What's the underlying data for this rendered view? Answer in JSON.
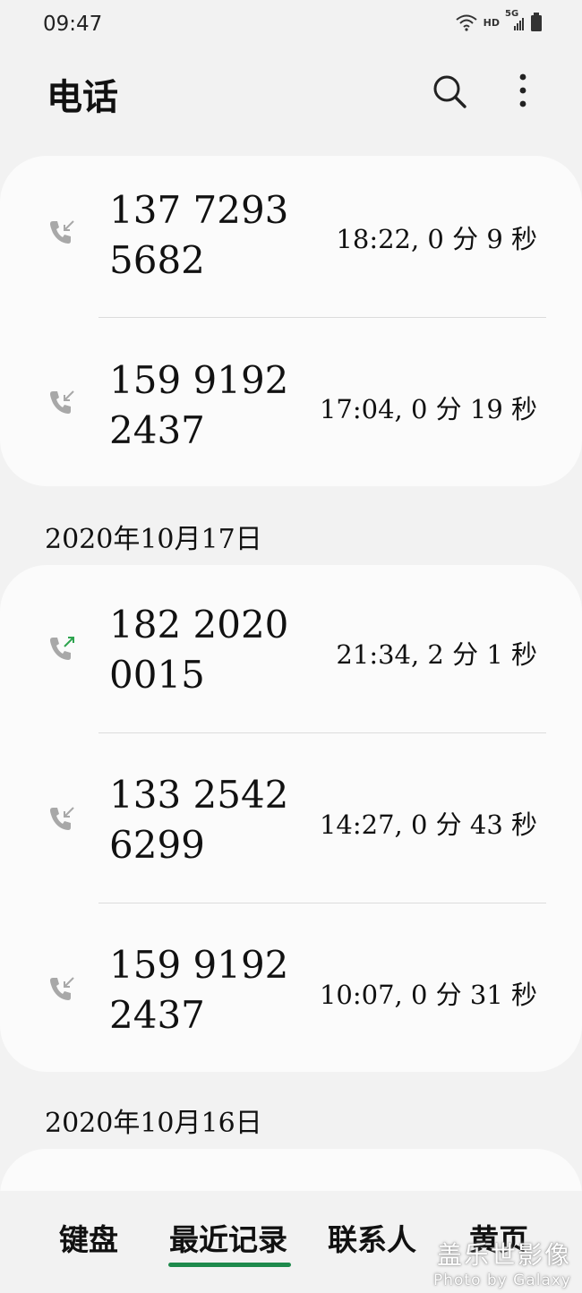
{
  "status_bar": {
    "time": "09:47",
    "hd_label": "HD",
    "net_label": "5G"
  },
  "header": {
    "title": "电话"
  },
  "groups": [
    {
      "date": "",
      "calls": [
        {
          "number_line1": "137 7293",
          "number_line2": "5682",
          "meta": "18:22, 0 分 9 秒",
          "direction": "incoming"
        },
        {
          "number_line1": "159 9192",
          "number_line2": "2437",
          "meta": "17:04, 0 分 19 秒",
          "direction": "incoming"
        }
      ]
    },
    {
      "date": "2020年10月17日",
      "calls": [
        {
          "number_line1": "182 2020",
          "number_line2": "0015",
          "meta": "21:34, 2 分 1 秒",
          "direction": "outgoing"
        },
        {
          "number_line1": "133 2542",
          "number_line2": "6299",
          "meta": "14:27, 0 分 43 秒",
          "direction": "incoming"
        },
        {
          "number_line1": "159 9192",
          "number_line2": "2437",
          "meta": "10:07, 0 分 31 秒",
          "direction": "incoming"
        }
      ]
    },
    {
      "date": "2020年10月16日",
      "calls": []
    }
  ],
  "bottom_nav": {
    "tabs": [
      {
        "label": "键盘"
      },
      {
        "label": "最近记录",
        "active": true
      },
      {
        "label": "联系人"
      },
      {
        "label": "黄页"
      }
    ]
  },
  "watermark": {
    "line1": "盖乐世影像",
    "line2": "Photo by Galaxy"
  },
  "colors": {
    "background": "#f2f2f2",
    "card": "#fbfbfb",
    "accent": "#1e8a4c",
    "incoming_icon": "#a8a8a8",
    "outgoing_icon": "#2ea44f"
  },
  "icons": {
    "search": "search-icon",
    "more": "more-vertical-icon",
    "incoming": "incoming-call-icon",
    "outgoing": "outgoing-call-icon"
  }
}
